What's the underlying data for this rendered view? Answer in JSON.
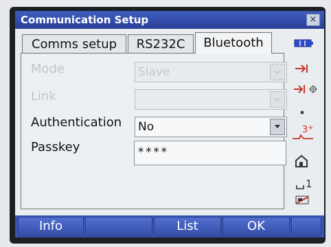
{
  "window": {
    "title": "Communication Setup",
    "close_glyph": "×"
  },
  "tabs": [
    {
      "label": "Comms setup"
    },
    {
      "label": "RS232C"
    },
    {
      "label": "Bluetooth"
    }
  ],
  "fields": {
    "mode": {
      "label": "Mode",
      "value": "Slave"
    },
    "link": {
      "label": "Link",
      "value": ""
    },
    "authentication": {
      "label": "Authentication",
      "value": "No"
    },
    "passkey": {
      "label": "Passkey",
      "value": "****"
    }
  },
  "side_icons": [
    "battery-icon",
    "target-prism-icon",
    "target-reflector-icon",
    "dot-icon",
    "laser-plummet-icon",
    "house-icon",
    "input-mode-icon",
    "signal-icon"
  ],
  "softkeys": [
    {
      "label": "Info"
    },
    {
      "label": ""
    },
    {
      "label": "List"
    },
    {
      "label": "OK"
    },
    {
      "label": ""
    }
  ],
  "colors": {
    "titlebar": "#3453b8",
    "softkey_bar": "#3a55b4",
    "accent_red": "#c8322a",
    "battery": "#2f49c8"
  }
}
